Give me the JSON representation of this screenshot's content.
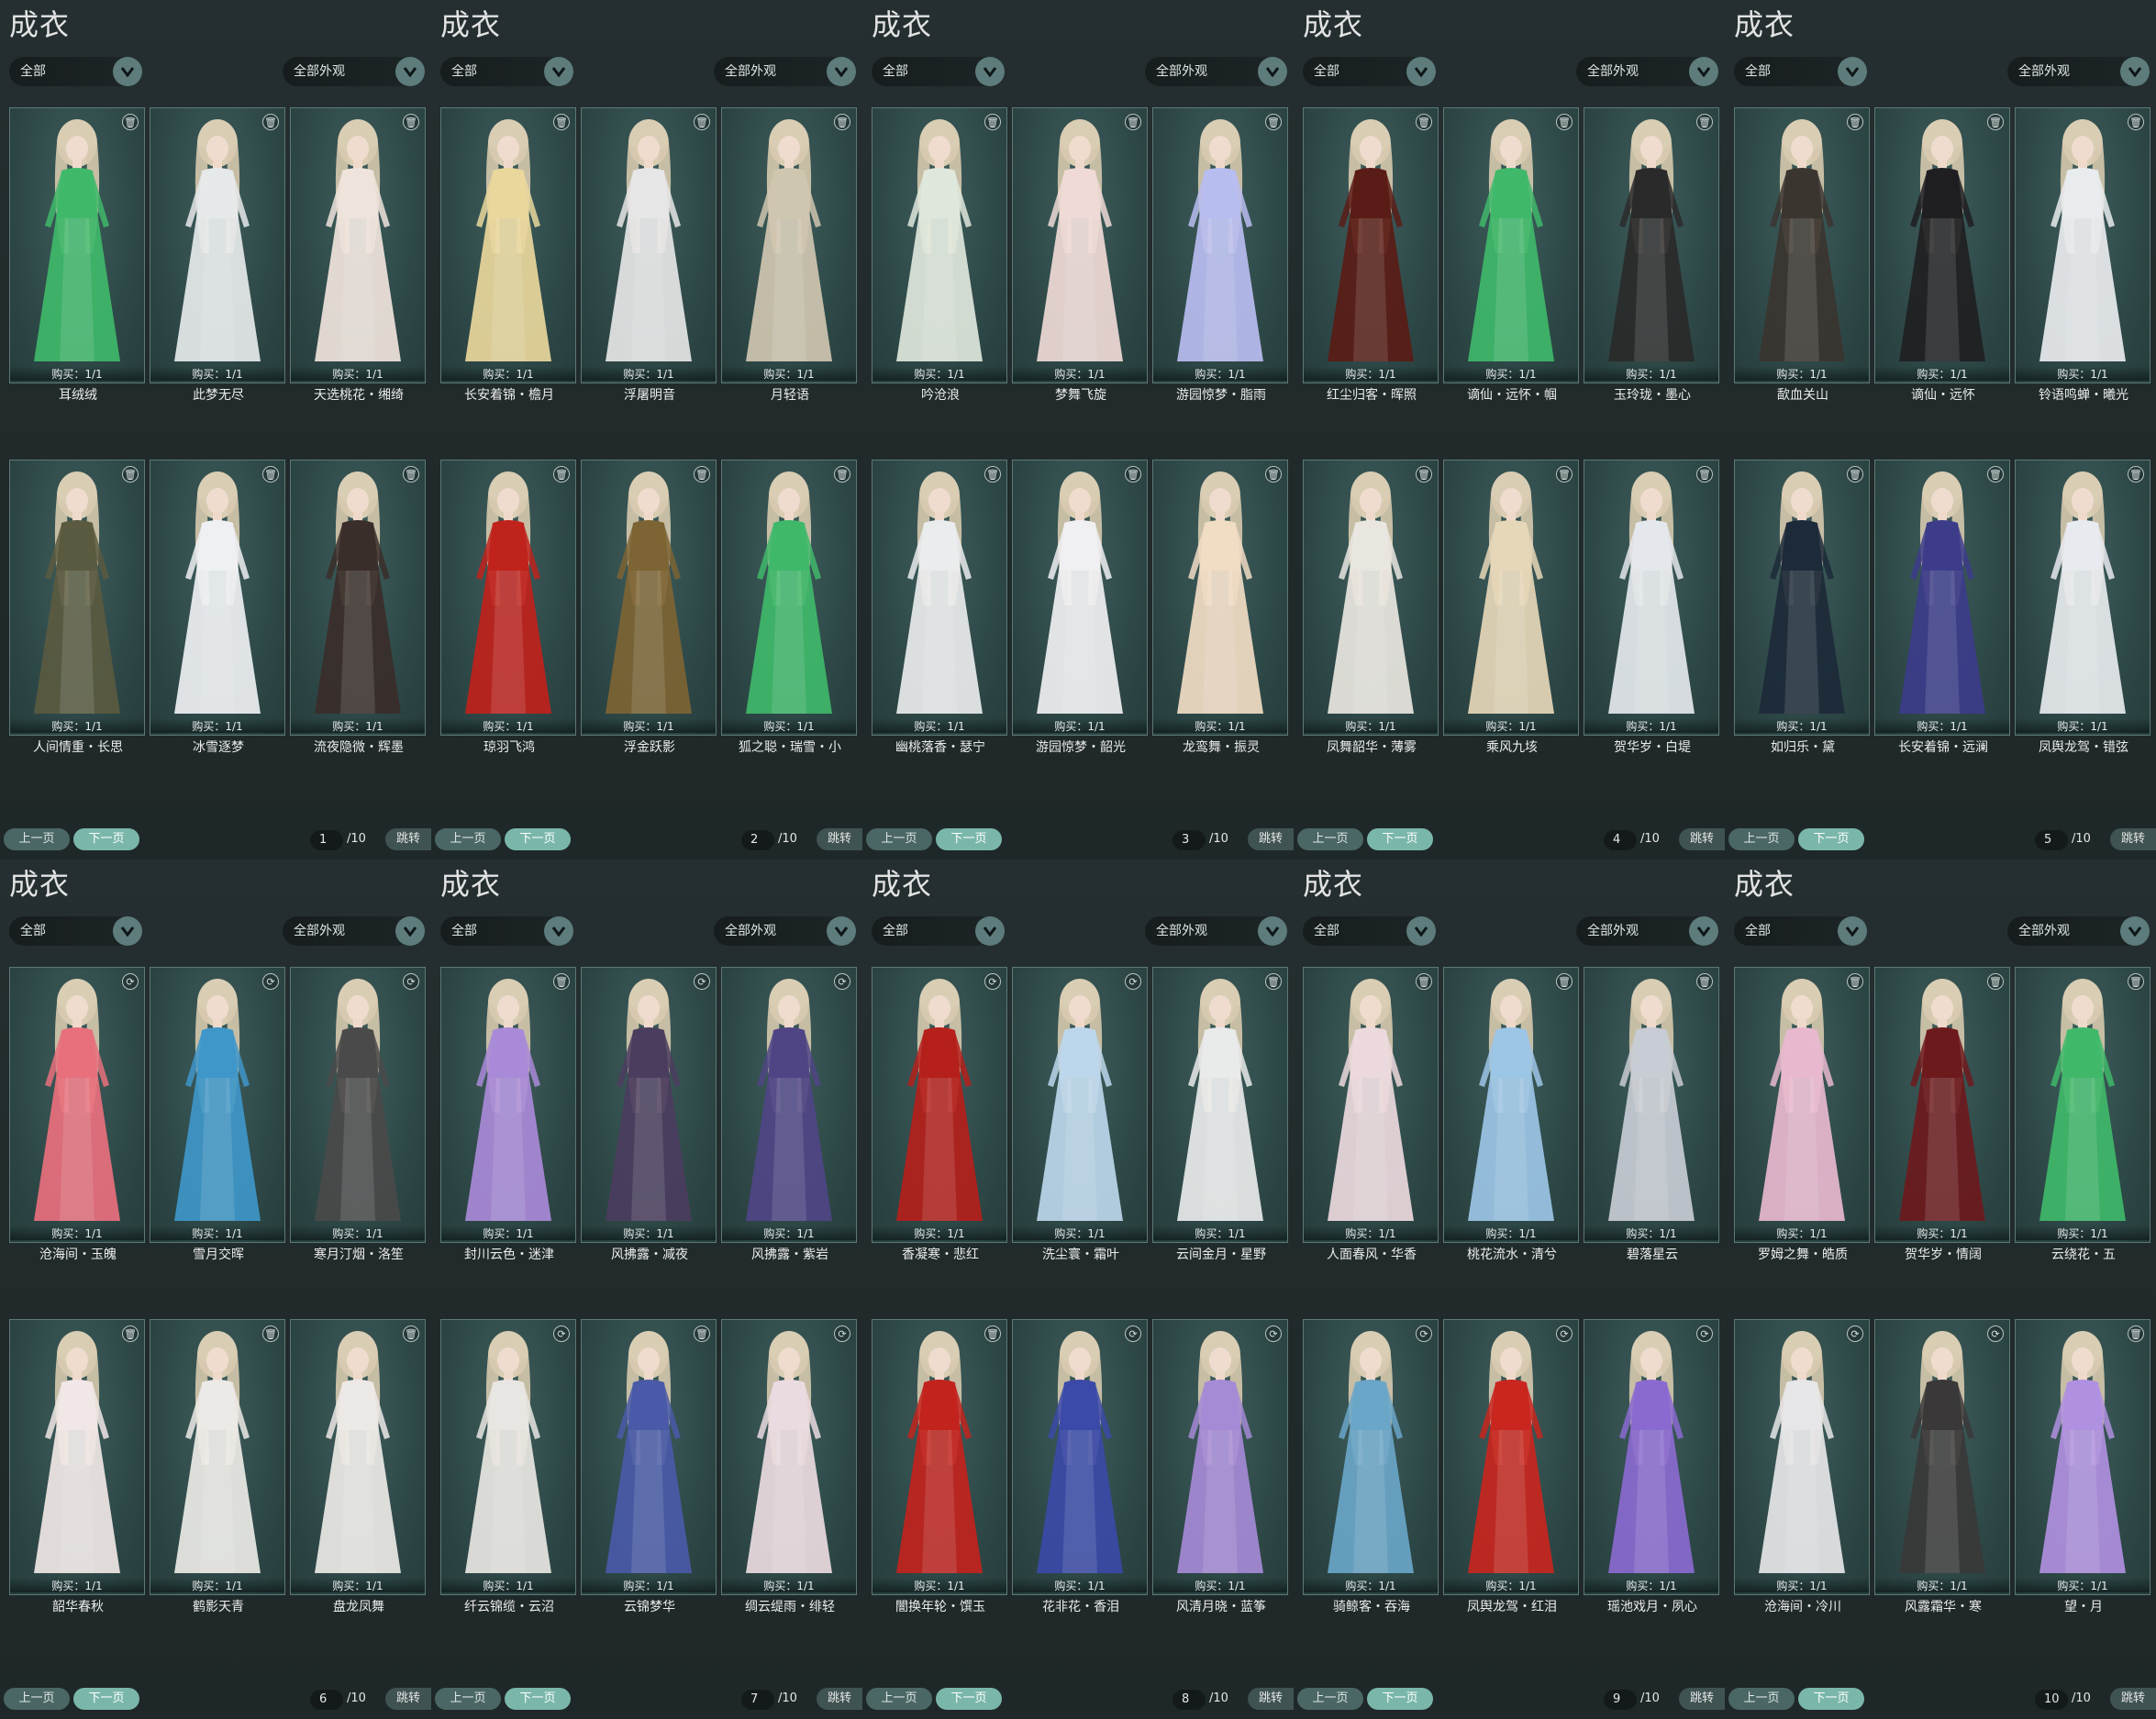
{
  "common": {
    "title": "成衣",
    "filter_category": "全部",
    "filter_appearance": "全部外观",
    "buy_label": "购买：1/1",
    "prev_label": "上一页",
    "next_label": "下一页",
    "jump_label": "跳转",
    "total_pages": "/10"
  },
  "colors": {
    "background": "#202a2b",
    "card": "#2f4a49",
    "card_border": "#5b7977",
    "accent": "#7ab7aa",
    "dropdown": "#5d7c7b"
  },
  "pages": [
    {
      "page": "1",
      "items": [
        {
          "name": "耳绒绒",
          "icon": "trash-icon",
          "outfit": "#3fb86a"
        },
        {
          "name": "此梦无尽",
          "icon": "trash-icon",
          "outfit": "#e6e9ea"
        },
        {
          "name": "天选桃花・缃绮",
          "icon": "trash-icon",
          "outfit": "#efe4dc"
        },
        {
          "name": "人间情重・长思",
          "icon": "trash-icon",
          "outfit": "#5a5a40"
        },
        {
          "name": "冰雪逐梦",
          "icon": "trash-icon",
          "outfit": "#eef0f3"
        },
        {
          "name": "流夜隐微・辉墨",
          "icon": "trash-icon",
          "outfit": "#3a2e2a"
        }
      ]
    },
    {
      "page": "2",
      "items": [
        {
          "name": "长安着锦・檐月",
          "icon": "trash-icon",
          "outfit": "#e9d79c"
        },
        {
          "name": "浮屠明音",
          "icon": "trash-icon",
          "outfit": "#e6e6e6"
        },
        {
          "name": "月轻语",
          "icon": "trash-icon",
          "outfit": "#cfc6b0"
        },
        {
          "name": "琼羽飞鸿",
          "icon": "trash-icon",
          "outfit": "#c0221c"
        },
        {
          "name": "浮金跃影",
          "icon": "trash-icon",
          "outfit": "#7d6434"
        },
        {
          "name": "狐之聪・瑞雪・小",
          "icon": "trash-icon",
          "outfit": "#3fb86a"
        }
      ]
    },
    {
      "page": "3",
      "items": [
        {
          "name": "吟沧浪",
          "icon": "trash-icon",
          "outfit": "#dfe7dc"
        },
        {
          "name": "梦舞飞旋",
          "icon": "trash-icon",
          "outfit": "#efdad6"
        },
        {
          "name": "游园惊梦・脂雨",
          "icon": "trash-icon",
          "outfit": "#b8bdf0"
        },
        {
          "name": "幽桃落香・瑟宁",
          "icon": "trash-icon",
          "outfit": "#eaeced"
        },
        {
          "name": "游园惊梦・韶光",
          "icon": "trash-icon",
          "outfit": "#f0f0f2"
        },
        {
          "name": "龙鸾舞・振灵",
          "icon": "trash-icon",
          "outfit": "#f1dcc4"
        }
      ]
    },
    {
      "page": "4",
      "items": [
        {
          "name": "红尘归客・晖照",
          "icon": "trash-icon",
          "outfit": "#5a1c16"
        },
        {
          "name": "谪仙・远怀・帼",
          "icon": "trash-icon",
          "outfit": "#3fb86a"
        },
        {
          "name": "玉玲珑・墨心",
          "icon": "trash-icon",
          "outfit": "#2a2a2a"
        },
        {
          "name": "凤舞韶华・薄雾",
          "icon": "trash-icon",
          "outfit": "#e9e6e0"
        },
        {
          "name": "乘风九垓",
          "icon": "trash-icon",
          "outfit": "#e6d7b8"
        },
        {
          "name": "贺华岁・白堤",
          "icon": "trash-icon",
          "outfit": "#e4e8ec"
        }
      ]
    },
    {
      "page": "5",
      "items": [
        {
          "name": "歃血关山",
          "icon": "trash-icon",
          "outfit": "#3b3530"
        },
        {
          "name": "谪仙・远怀",
          "icon": "trash-icon",
          "outfit": "#1f1f22"
        },
        {
          "name": "铃语鸣蝉・曦光",
          "icon": "trash-icon",
          "outfit": "#e9ecef"
        },
        {
          "name": "如归乐・黛",
          "icon": "trash-icon",
          "outfit": "#1d2a3a"
        },
        {
          "name": "长安着锦・远澜",
          "icon": "trash-icon",
          "outfit": "#3c3c8a"
        },
        {
          "name": "凤舆龙驾・错弦",
          "icon": "trash-icon",
          "outfit": "#e7eaee"
        }
      ]
    },
    {
      "page": "6",
      "items": [
        {
          "name": "沧海间・玉魄",
          "icon": "link-icon",
          "outfit": "#e8707d"
        },
        {
          "name": "雪月交晖",
          "icon": "link-icon",
          "outfit": "#3f97c9"
        },
        {
          "name": "寒月汀烟・洛笙",
          "icon": "link-icon",
          "outfit": "#4a4a4a"
        },
        {
          "name": "韶华春秋",
          "icon": "trash-icon",
          "outfit": "#f0e7e6"
        },
        {
          "name": "鹤影天青",
          "icon": "trash-icon",
          "outfit": "#eceae6"
        },
        {
          "name": "盘龙凤舞",
          "icon": "trash-icon",
          "outfit": "#ece9e6"
        }
      ]
    },
    {
      "page": "7",
      "items": [
        {
          "name": "封川云色・迷津",
          "icon": "trash-icon",
          "outfit": "#a98ad8"
        },
        {
          "name": "风拂露・减夜",
          "icon": "link-icon",
          "outfit": "#4b3d5e"
        },
        {
          "name": "风拂露・紫岩",
          "icon": "link-icon",
          "outfit": "#4f4585"
        },
        {
          "name": "纤云锦缆・云沼",
          "icon": "link-icon",
          "outfit": "#e8e6e2"
        },
        {
          "name": "云锦梦华",
          "icon": "trash-icon",
          "outfit": "#4a5aa8"
        },
        {
          "name": "绸云缇雨・绯轻",
          "icon": "link-icon",
          "outfit": "#eadbe0"
        }
      ]
    },
    {
      "page": "8",
      "items": [
        {
          "name": "香凝寒・悲红",
          "icon": "link-icon",
          "outfit": "#b5201b"
        },
        {
          "name": "洗尘寰・霜叶",
          "icon": "link-icon",
          "outfit": "#bcd7ec"
        },
        {
          "name": "云间金月・星野",
          "icon": "trash-icon",
          "outfit": "#e9eaea"
        },
        {
          "name": "闇换年轮・馔玉",
          "icon": "trash-icon",
          "outfit": "#c2231d"
        },
        {
          "name": "花非花・香泪",
          "icon": "link-icon",
          "outfit": "#3b4aa8"
        },
        {
          "name": "风清月晓・蓝筝",
          "icon": "link-icon",
          "outfit": "#a58ad6"
        }
      ]
    },
    {
      "page": "9",
      "items": [
        {
          "name": "人面春风・华香",
          "icon": "trash-icon",
          "outfit": "#ecd9dd"
        },
        {
          "name": "桃花流水・清兮",
          "icon": "trash-icon",
          "outfit": "#9cc6e6"
        },
        {
          "name": "碧落星云",
          "icon": "trash-icon",
          "outfit": "#c8ccd4"
        },
        {
          "name": "骑鲸客・吞海",
          "icon": "link-icon",
          "outfit": "#6aa6c8"
        },
        {
          "name": "凤舆龙驾・红泪",
          "icon": "link-icon",
          "outfit": "#c8261e"
        },
        {
          "name": "瑶池戏月・夙心",
          "icon": "link-icon",
          "outfit": "#8a6ad0"
        }
      ]
    },
    {
      "page": "10",
      "items": [
        {
          "name": "罗姆之舞・皓质",
          "icon": "trash-icon",
          "outfit": "#e8b8cf"
        },
        {
          "name": "贺华岁・情阔",
          "icon": "trash-icon",
          "outfit": "#6d1a1d"
        },
        {
          "name": "云绕花・五",
          "icon": "trash-icon",
          "outfit": "#3fb86a"
        },
        {
          "name": "沧海间・冷川",
          "icon": "link-icon",
          "outfit": "#e6e6e8"
        },
        {
          "name": "风露霜华・寒",
          "icon": "link-icon",
          "outfit": "#3a3838"
        },
        {
          "name": "望・月",
          "icon": "trash-icon",
          "outfit": "#b090e0"
        }
      ]
    }
  ]
}
